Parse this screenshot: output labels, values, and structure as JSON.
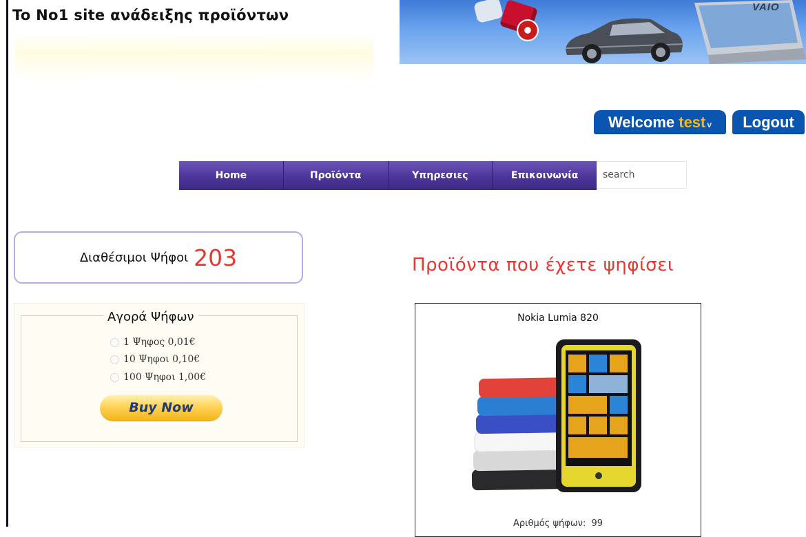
{
  "site": {
    "title": "To No1 site ανάδειξης προϊόντων"
  },
  "banner": {
    "brand_text": "VAIO"
  },
  "user": {
    "welcome_label": "Welcome",
    "username": "test",
    "caret": "v",
    "logout_label": "Logout"
  },
  "nav": {
    "items": [
      {
        "label": "Home"
      },
      {
        "label": "Προϊόντα"
      },
      {
        "label": "Υπηρεσιες"
      },
      {
        "label": "Επικοινωνία"
      }
    ],
    "search_placeholder": "search"
  },
  "votes": {
    "label": "Διαθέσιμοι Ψήφοι",
    "count": "203"
  },
  "buy": {
    "legend": "Αγορά Ψήφων",
    "options": [
      {
        "label": "1 Ψηφος 0,01€"
      },
      {
        "label": "10 Ψηφοι 0,10€"
      },
      {
        "label": "100 Ψηφοι 1,00€"
      }
    ],
    "button_label": "Buy Now"
  },
  "voted": {
    "heading": "Προϊόντα που έχετε ψηφίσει",
    "products": [
      {
        "name": "Nokia Lumia 820",
        "votes_label": "Αριθμός ψήφων:",
        "votes": "99"
      }
    ]
  },
  "colors": {
    "nav": "#4c3599",
    "user_buttons": "#0a55b0",
    "accent_red": "#e23a31",
    "username": "#f7b900"
  }
}
